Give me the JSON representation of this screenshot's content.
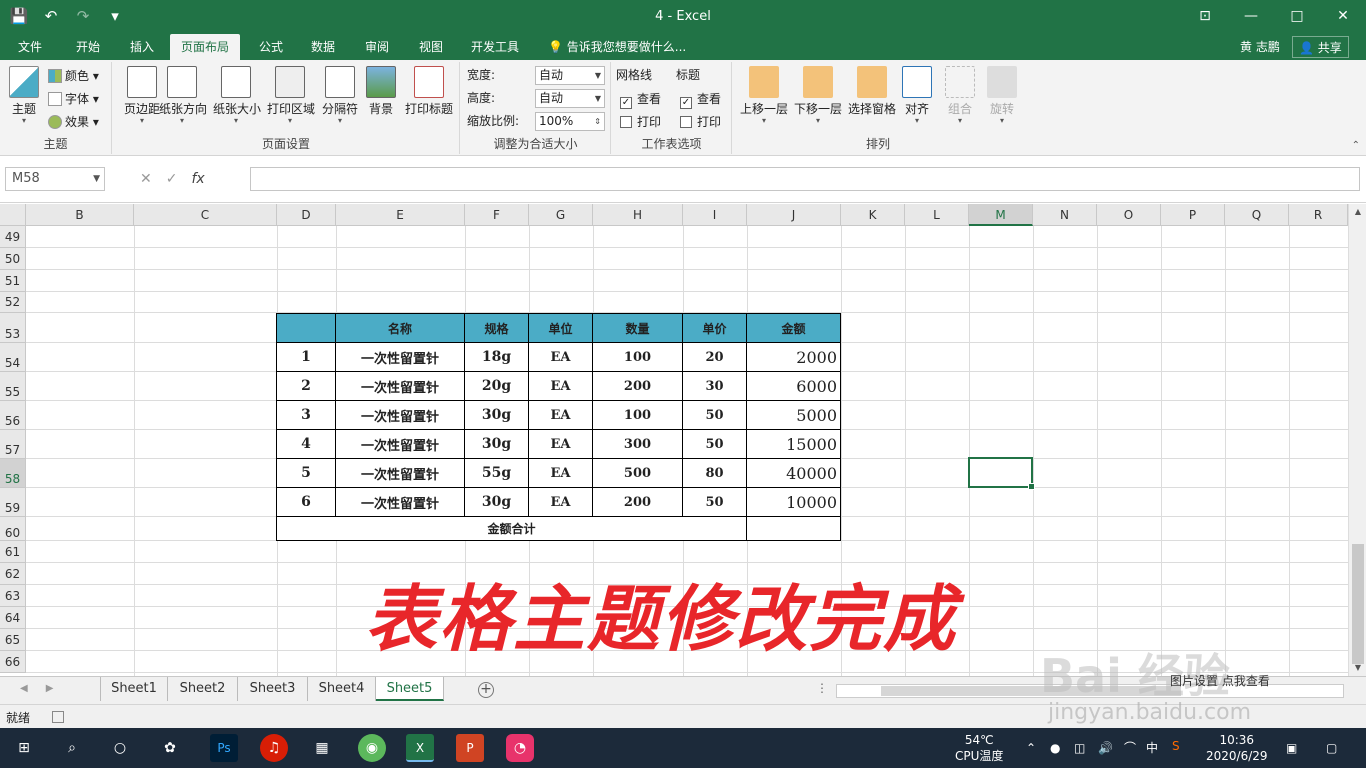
{
  "window": {
    "title": "4 - Excel",
    "min": "—",
    "max": "□",
    "close": "✕",
    "restore": "⊡"
  },
  "qat": {
    "save": "💾",
    "undo": "↶",
    "redo": "↷",
    "more": "▾"
  },
  "tabs": [
    "文件",
    "开始",
    "插入",
    "页面布局",
    "公式",
    "数据",
    "审阅",
    "视图",
    "开发工具"
  ],
  "tell_me": "告诉我您想要做什么...",
  "user": "黄 志鹏",
  "share": "共享",
  "ribbon": {
    "themes": {
      "theme": "主题",
      "colors": "颜色",
      "fonts": "字体",
      "effects": "效果",
      "group": "主题"
    },
    "page_setup": {
      "margins": "页边距",
      "orientation": "纸张方向",
      "size": "纸张大小",
      "print_area": "打印区域",
      "breaks": "分隔符",
      "background": "背景",
      "print_titles": "打印标题",
      "group": "页面设置"
    },
    "scale": {
      "width_label": "宽度:",
      "width_val": "自动",
      "height_label": "高度:",
      "height_val": "自动",
      "scale_label": "缩放比例:",
      "scale_val": "100%",
      "group": "调整为合适大小"
    },
    "sheet_options": {
      "gridlines": "网格线",
      "headings": "标题",
      "view": "查看",
      "print": "打印",
      "group": "工作表选项"
    },
    "arrange": {
      "bring_forward": "上移一层",
      "send_backward": "下移一层",
      "selection_pane": "选择窗格",
      "align": "对齐",
      "group_btn": "组合",
      "rotate": "旋转",
      "group": "排列"
    }
  },
  "formula_bar": {
    "name_box": "M58",
    "cancel": "✕",
    "enter": "✓",
    "fx": "fx",
    "value": ""
  },
  "columns": [
    "B",
    "C",
    "D",
    "E",
    "F",
    "G",
    "H",
    "I",
    "J",
    "K",
    "L",
    "M",
    "N",
    "O",
    "P",
    "Q",
    "R"
  ],
  "rows": [
    "49",
    "50",
    "51",
    "52",
    "53",
    "54",
    "55",
    "56",
    "57",
    "58",
    "59",
    "60",
    "61",
    "62",
    "63",
    "64",
    "65",
    "66"
  ],
  "table": {
    "headers": [
      "",
      "名称",
      "规格",
      "单位",
      "数量",
      "单价",
      "金额"
    ],
    "rows": [
      [
        "1",
        "一次性留置针",
        "18g",
        "EA",
        "100",
        "20",
        "2000"
      ],
      [
        "2",
        "一次性留置针",
        "20g",
        "EA",
        "200",
        "30",
        "6000"
      ],
      [
        "3",
        "一次性留置针",
        "30g",
        "EA",
        "100",
        "50",
        "5000"
      ],
      [
        "4",
        "一次性留置针",
        "30g",
        "EA",
        "300",
        "50",
        "15000"
      ],
      [
        "5",
        "一次性留置针",
        "55g",
        "EA",
        "500",
        "80",
        "40000"
      ],
      [
        "6",
        "一次性留置针",
        "30g",
        "EA",
        "200",
        "50",
        "10000"
      ]
    ],
    "total_label": "金额合计",
    "header_color": "#4bacc6"
  },
  "overlay_text": "表格主题修改完成",
  "sheets": [
    "Sheet1",
    "Sheet2",
    "Sheet3",
    "Sheet4",
    "Sheet5"
  ],
  "active_sheet": "Sheet5",
  "status": {
    "ready": "就绪"
  },
  "watermark": {
    "brand": "Bai 经验",
    "url": "jingyan.baidu.com",
    "small": "图片设置 点我查看"
  },
  "taskbar": {
    "temp": "54℃",
    "temp_label": "CPU温度",
    "ime": "中",
    "time": "10:36",
    "date": "2020/6/29"
  },
  "colors": {
    "excel_green": "#217346",
    "accent_red": "#e8262a"
  }
}
